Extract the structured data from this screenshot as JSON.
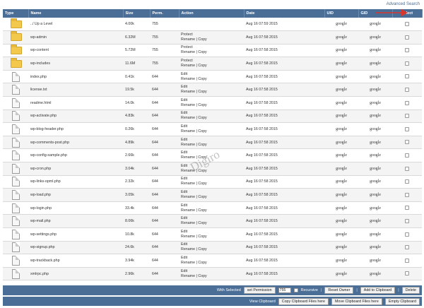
{
  "top_link": "Advanced Search",
  "watermark": "Digiro",
  "columns": {
    "type": "Type",
    "name": "Name",
    "size": "Size",
    "perm": "Perm.",
    "action": "Action",
    "date": "Date",
    "uid": "UID",
    "gid": "GID",
    "select": "Select"
  },
  "rows": [
    {
      "kind": "folder",
      "name": "../ Up a Level",
      "size": "4.00k",
      "perm": "755",
      "action1": "",
      "action2": "",
      "date": "Aug 16 07:59 2015",
      "uid": "google",
      "gid": "google"
    },
    {
      "kind": "folder",
      "name": "wp-admin",
      "size": "6.32M",
      "perm": "755",
      "action1": "Protect",
      "action2": "Rename | Copy",
      "date": "Aug 16 07:58 2015",
      "uid": "google",
      "gid": "google"
    },
    {
      "kind": "folder",
      "name": "wp-content",
      "size": "5.72M",
      "perm": "755",
      "action1": "Protect",
      "action2": "Rename | Copy",
      "date": "Aug 16 07:58 2015",
      "uid": "google",
      "gid": "google"
    },
    {
      "kind": "folder",
      "name": "wp-includes",
      "size": "11.6M",
      "perm": "755",
      "action1": "Protect",
      "action2": "Rename | Copy",
      "date": "Aug 16 07:58 2015",
      "uid": "google",
      "gid": "google"
    },
    {
      "kind": "file",
      "name": "index.php",
      "size": "0.41k",
      "perm": "644",
      "action1": "Edit",
      "action2": "Rename | Copy",
      "date": "Aug 16 07:58 2015",
      "uid": "google",
      "gid": "google"
    },
    {
      "kind": "file",
      "name": "license.txt",
      "size": "19.5k",
      "perm": "644",
      "action1": "Edit",
      "action2": "Rename | Copy",
      "date": "Aug 16 07:58 2015",
      "uid": "google",
      "gid": "google"
    },
    {
      "kind": "file",
      "name": "readme.html",
      "size": "14.0k",
      "perm": "644",
      "action1": "Edit",
      "action2": "Rename | Copy",
      "date": "Aug 16 07:58 2015",
      "uid": "google",
      "gid": "google"
    },
    {
      "kind": "file",
      "name": "wp-activate.php",
      "size": "4.83k",
      "perm": "644",
      "action1": "Edit",
      "action2": "Rename | Copy",
      "date": "Aug 16 07:58 2015",
      "uid": "google",
      "gid": "google"
    },
    {
      "kind": "file",
      "name": "wp-blog-header.php",
      "size": "0.26k",
      "perm": "644",
      "action1": "Edit",
      "action2": "Rename | Copy",
      "date": "Aug 16 07:58 2015",
      "uid": "google",
      "gid": "google"
    },
    {
      "kind": "file",
      "name": "wp-comments-post.php",
      "size": "4.89k",
      "perm": "644",
      "action1": "Edit",
      "action2": "Rename | Copy",
      "date": "Aug 16 07:58 2015",
      "uid": "google",
      "gid": "google"
    },
    {
      "kind": "file",
      "name": "wp-config-sample.php",
      "size": "2.66k",
      "perm": "644",
      "action1": "Edit",
      "action2": "Rename | Copy",
      "date": "Aug 16 07:58 2015",
      "uid": "google",
      "gid": "google"
    },
    {
      "kind": "file",
      "name": "wp-cron.php",
      "size": "3.04k",
      "perm": "644",
      "action1": "Edit",
      "action2": "Rename | Copy",
      "date": "Aug 16 07:58 2015",
      "uid": "google",
      "gid": "google"
    },
    {
      "kind": "file",
      "name": "wp-links-opml.php",
      "size": "2.32k",
      "perm": "644",
      "action1": "Edit",
      "action2": "Rename | Copy",
      "date": "Aug 16 07:58 2015",
      "uid": "google",
      "gid": "google"
    },
    {
      "kind": "file",
      "name": "wp-load.php",
      "size": "3.05k",
      "perm": "644",
      "action1": "Edit",
      "action2": "Rename | Copy",
      "date": "Aug 16 07:58 2015",
      "uid": "google",
      "gid": "google"
    },
    {
      "kind": "file",
      "name": "wp-login.php",
      "size": "33.4k",
      "perm": "644",
      "action1": "Edit",
      "action2": "Rename | Copy",
      "date": "Aug 16 07:58 2015",
      "uid": "google",
      "gid": "google"
    },
    {
      "kind": "file",
      "name": "wp-mail.php",
      "size": "8.06k",
      "perm": "644",
      "action1": "Edit",
      "action2": "Rename | Copy",
      "date": "Aug 16 07:58 2015",
      "uid": "google",
      "gid": "google"
    },
    {
      "kind": "file",
      "name": "wp-settings.php",
      "size": "10.8k",
      "perm": "644",
      "action1": "Edit",
      "action2": "Rename | Copy",
      "date": "Aug 16 07:58 2015",
      "uid": "google",
      "gid": "google"
    },
    {
      "kind": "file",
      "name": "wp-signup.php",
      "size": "24.6k",
      "perm": "644",
      "action1": "Edit",
      "action2": "Rename | Copy",
      "date": "Aug 16 07:58 2015",
      "uid": "google",
      "gid": "google"
    },
    {
      "kind": "file",
      "name": "wp-trackback.php",
      "size": "3.94k",
      "perm": "644",
      "action1": "Edit",
      "action2": "Rename | Copy",
      "date": "Aug 16 07:58 2015",
      "uid": "google",
      "gid": "google"
    },
    {
      "kind": "file",
      "name": "xmlrpc.php",
      "size": "2.96k",
      "perm": "644",
      "action1": "Edit",
      "action2": "Rename | Copy",
      "date": "Aug 16 07:58 2015",
      "uid": "google",
      "gid": "google"
    }
  ],
  "footer": {
    "with_selected": "With Selected",
    "set_permission": "set Permission",
    "permission_value": "755",
    "recursive": "Recursive",
    "reset_owner": "Reset Owner",
    "add_clipboard": "Add to Clipboard",
    "delete": "Delete",
    "view_clipboard": "View Clipboard",
    "copy_clipboard": "Copy Clipboard Files here",
    "move_clipboard": "Move Clipboard Files here",
    "empty_clipboard": "Empty Clipboard"
  },
  "colors": {
    "header_bar": "#4b6e97",
    "folder": "#f2c94c",
    "link": "#4a6d93"
  }
}
